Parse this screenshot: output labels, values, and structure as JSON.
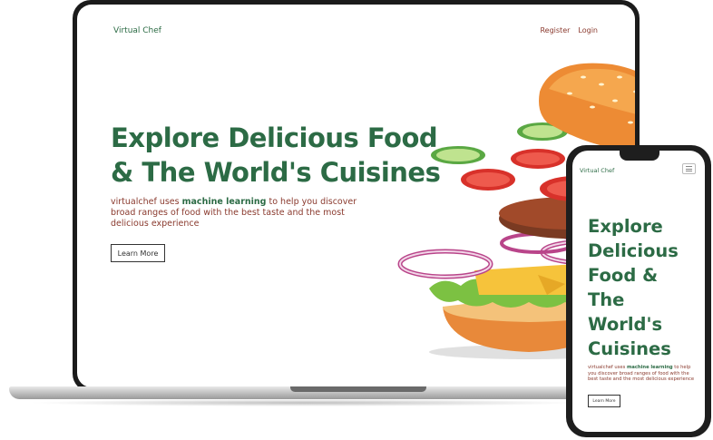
{
  "desktop": {
    "brand": "Virtual Chef",
    "nav": {
      "register": "Register",
      "login": "Login"
    },
    "hero": {
      "title_line1": "Explore Delicious Food",
      "title_line2": "& The World's Cuisines",
      "desc_prefix": "virtualchef uses ",
      "desc_highlight": "machine learning",
      "desc_suffix": " to help you discover broad ranges of food with the best taste and the most delicious experience",
      "button": "Learn More"
    }
  },
  "mobile": {
    "brand": "Virtual Chef",
    "menu_icon": "hamburger-menu-icon",
    "hero": {
      "title_line1": "Explore",
      "title_line2": "Delicious",
      "title_line3": "Food &",
      "title_line4": "The",
      "title_line5": "World's",
      "title_line6": "Cuisines",
      "desc_prefix": "virtualchef uses ",
      "desc_highlight": "machine learning",
      "desc_suffix": " to help you discover broad ranges of food with the best taste and the most delicious experience",
      "button": "Learn More"
    }
  },
  "colors": {
    "brand_green": "#2c6b45",
    "text_red": "#8a3a2e",
    "device_black": "#1b1b1b"
  },
  "illustration": "burger-illustration"
}
